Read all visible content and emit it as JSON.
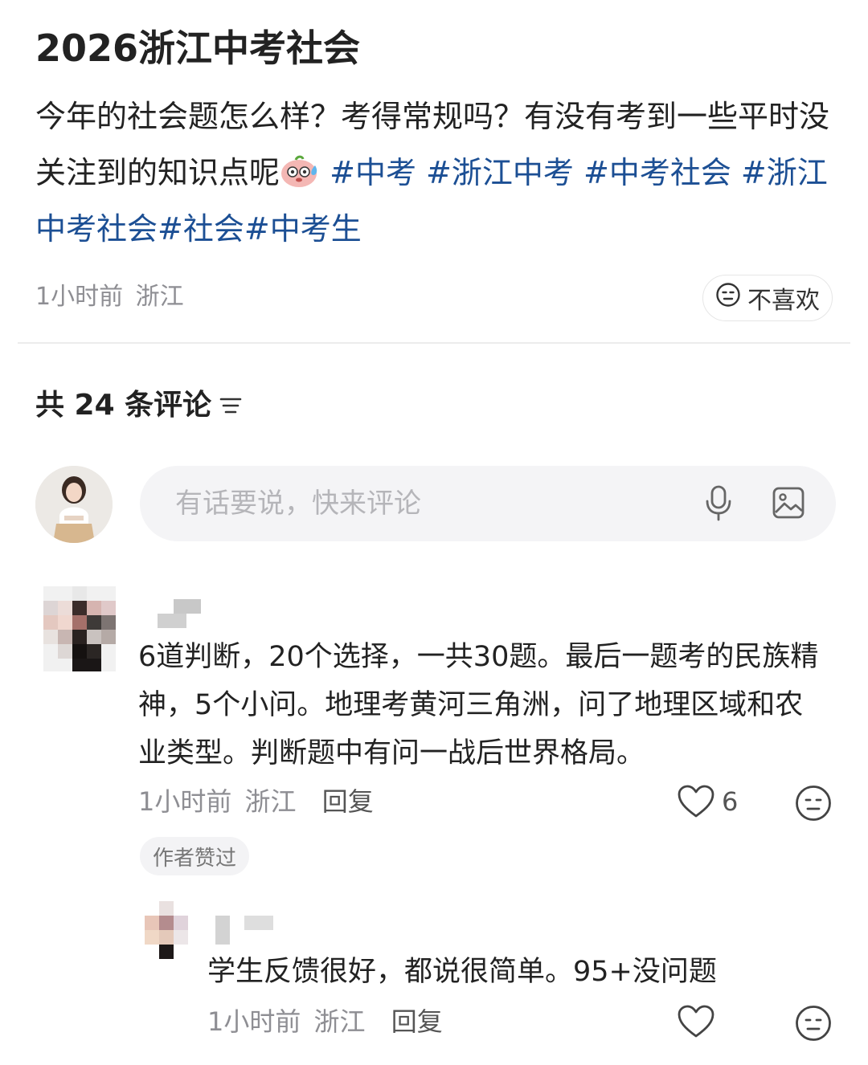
{
  "post": {
    "title": "2026浙江中考社会",
    "body_part1": "今年的社会题怎么样？考得常规吗？有没有考到一些平时没关注到的知识点呢",
    "emoji": "sweating-face-emoji",
    "tags": [
      "#中考",
      "#浙江中考",
      "#中考社会",
      "#浙江中考社会",
      "#社会",
      "#中考生"
    ],
    "time": "1小时前",
    "location": "浙江",
    "dislike_label": "不喜欢"
  },
  "comments_header": {
    "label": "共 24 条评论",
    "sort_icon": "sort-lines-icon"
  },
  "comment_input": {
    "placeholder": "有话要说，快来评论",
    "voice_icon": "microphone-icon",
    "image_icon": "image-icon"
  },
  "comments": [
    {
      "text": "6道判断，20个选择，一共30题。最后一题考的民族精神，5个小问。地理考黄河三角洲，问了地理区域和农业类型。判断题中有问一战后世界格局。",
      "time": "1小时前",
      "location": "浙江",
      "reply_label": "回复",
      "likes": "6",
      "badge": "作者赞过",
      "replies": [
        {
          "text": "学生反馈很好，都说很简单。95+没问题",
          "time": "1小时前",
          "location": "浙江",
          "reply_label": "回复"
        }
      ]
    }
  ],
  "colors": {
    "tag": "#1c4f94",
    "meta": "#8e8e93",
    "input_bg": "#f4f4f6",
    "divider": "#ececec"
  }
}
